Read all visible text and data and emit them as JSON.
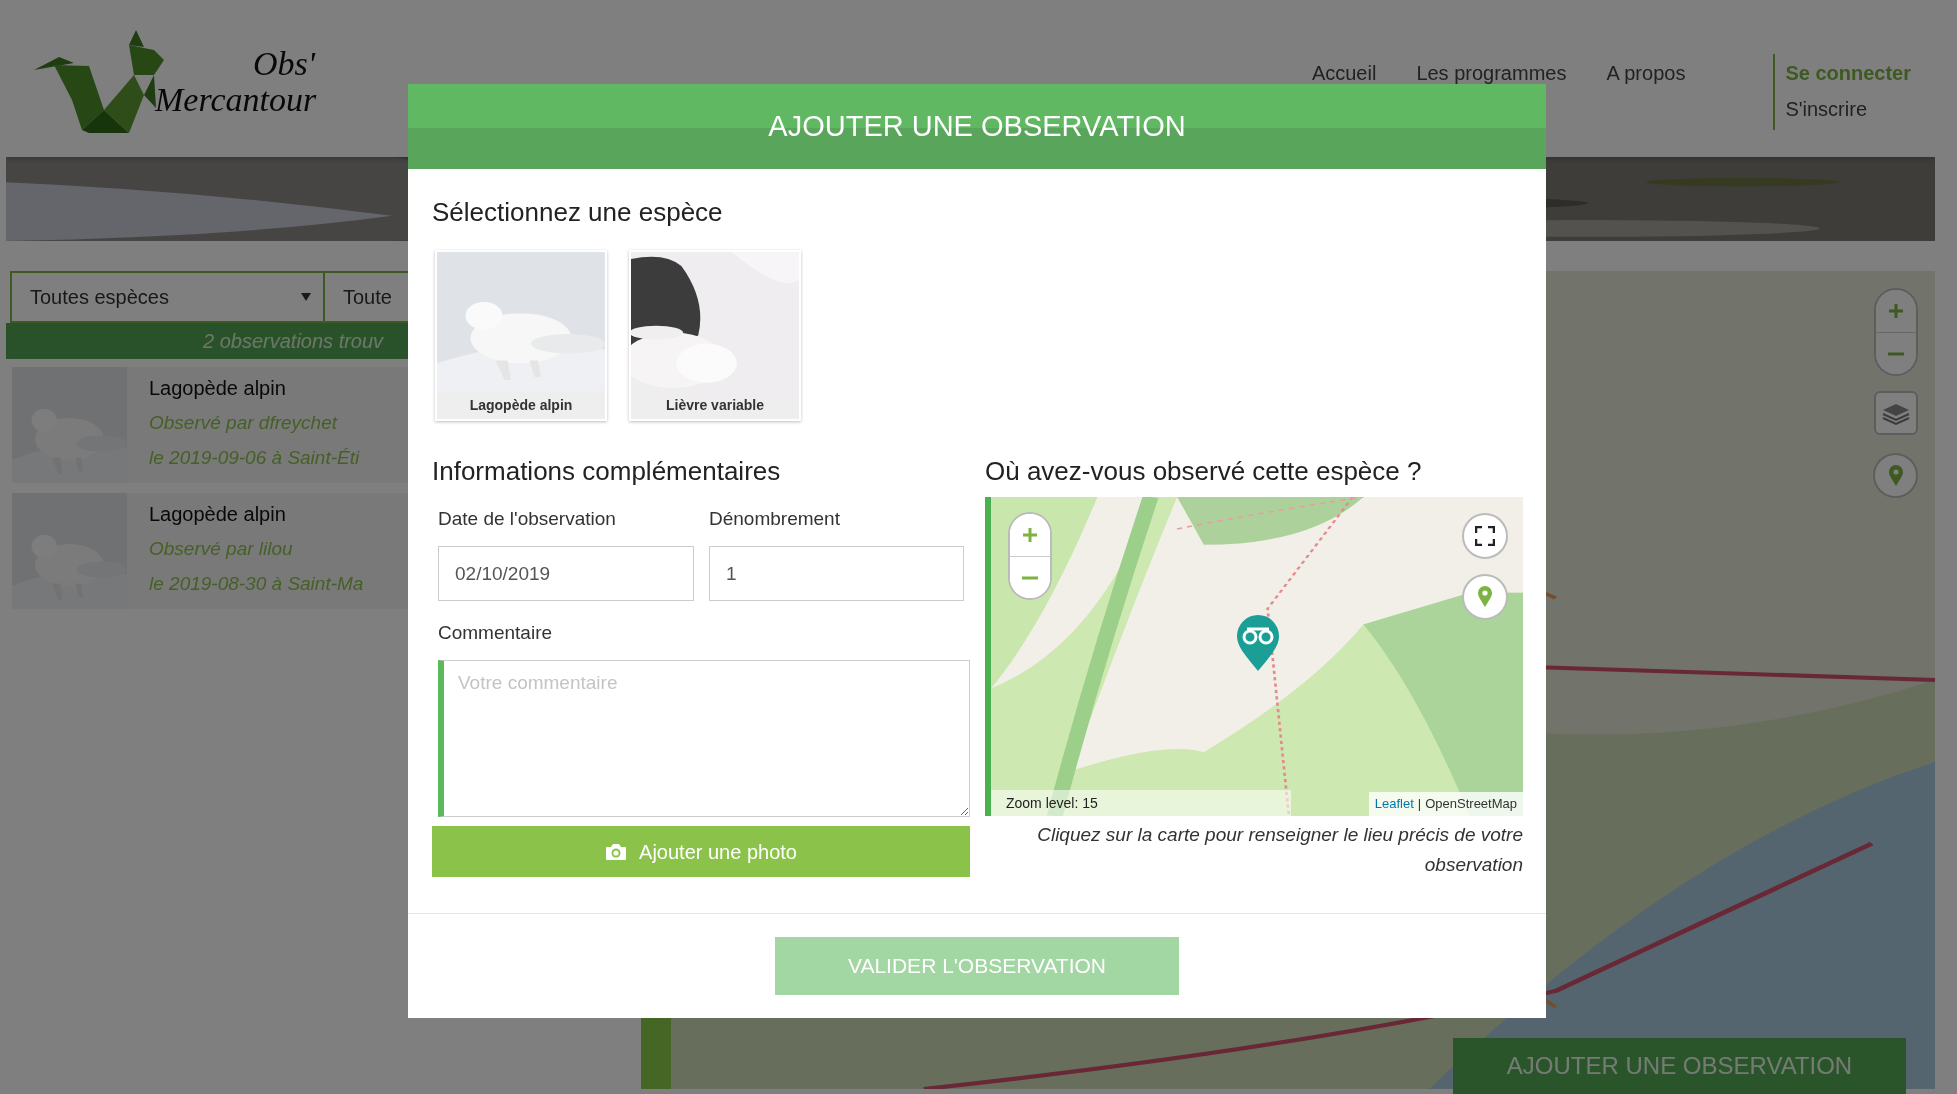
{
  "header": {
    "logo_line_1": "Obs'",
    "logo_line_2": "Mercantour",
    "nav": [
      {
        "label": "Accueil"
      },
      {
        "label": "Les programmes"
      },
      {
        "label": "A propos"
      }
    ],
    "account": [
      {
        "label": "Se connecter",
        "kind": "primary"
      },
      {
        "label": "S'inscrire",
        "kind": "plain"
      }
    ]
  },
  "filters": [
    {
      "label": "Toutes espèces",
      "kind": "dropdown"
    },
    {
      "label": "Toute",
      "kind": "plain"
    }
  ],
  "results_count": "2 observations trouv",
  "observations": [
    {
      "species": "Lagopède alpin",
      "observer": "Observé par dfreychet",
      "details": "le 2019-09-06 à Saint-Éti"
    },
    {
      "species": "Lagopède alpin",
      "observer": "Observé par lilou",
      "details": "le 2019-08-30 à Saint-Ma"
    }
  ],
  "add_button": "AJOUTER UNE OBSERVATION",
  "modal": {
    "title": "AJOUTER UNE OBSERVATION",
    "species_heading": "Sélectionnez une espèce",
    "species": [
      {
        "name": "Lagopède alpin",
        "kind": "bird",
        "selected": false
      },
      {
        "name": "Lièvre variable",
        "kind": "hare",
        "selected": false
      }
    ],
    "info_heading": "Informations complémentaires",
    "fields": [
      {
        "label": "Date de l'observation",
        "value": "02/10/2019"
      },
      {
        "label": "Dénombrement",
        "value": "1"
      }
    ],
    "comment": {
      "label": "Commentaire",
      "placeholder": "Votre commentaire"
    },
    "photo_button": "Ajouter une photo",
    "location_heading": "Où avez-vous observé cette espèce ?",
    "map": {
      "zoom_level": "Zoom level: 15",
      "attribution_link": "Leaflet",
      "attribution_separator": "|",
      "attribution_text": "OpenStreetMap"
    },
    "map_hint": "Cliquez sur la carte pour renseigner le lieu précis de votre observation",
    "submit": {
      "label": "VALIDER L'OBSERVATION",
      "disabled": true
    }
  }
}
